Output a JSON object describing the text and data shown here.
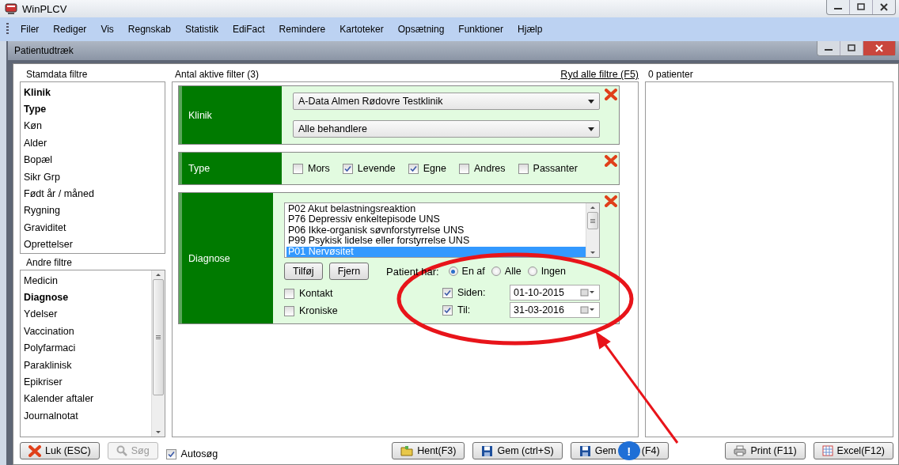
{
  "window": {
    "title": "WinPLCV"
  },
  "menu": [
    "Filer",
    "Rediger",
    "Vis",
    "Regnskab",
    "Statistik",
    "EdiFact",
    "Remindere",
    "Kartoteker",
    "Opsætning",
    "Funktioner",
    "Hjælp"
  ],
  "dialog": {
    "title": "Patientudtræk"
  },
  "stamdata": {
    "heading": "Stamdata filtre",
    "items": [
      {
        "label": "Klinik",
        "active": true
      },
      {
        "label": "Type",
        "active": true
      },
      {
        "label": "Køn",
        "active": false
      },
      {
        "label": "Alder",
        "active": false
      },
      {
        "label": "Bopæl",
        "active": false
      },
      {
        "label": "Sikr Grp",
        "active": false
      },
      {
        "label": "Født år / måned",
        "active": false
      },
      {
        "label": "Rygning",
        "active": false
      },
      {
        "label": "Graviditet",
        "active": false
      },
      {
        "label": "Oprettelser",
        "active": false
      }
    ]
  },
  "andre": {
    "heading": "Andre filtre",
    "items": [
      {
        "label": "Medicin",
        "active": false
      },
      {
        "label": "Diagnose",
        "active": true
      },
      {
        "label": "Ydelser",
        "active": false
      },
      {
        "label": "Vaccination",
        "active": false
      },
      {
        "label": "Polyfarmaci",
        "active": false
      },
      {
        "label": "Paraklinisk",
        "active": false
      },
      {
        "label": "Epikriser",
        "active": false
      },
      {
        "label": "Kalender aftaler",
        "active": false
      },
      {
        "label": "Journalnotat",
        "active": false
      }
    ]
  },
  "filters": {
    "heading": "Antal aktive filter (3)",
    "clear_link": "Ryd alle filtre (F5)"
  },
  "klinik": {
    "label": "Klinik",
    "clinic": "A-Data Almen Rødovre Testklinik",
    "provider": "Alle behandlere"
  },
  "type": {
    "label": "Type",
    "options": [
      {
        "label": "Mors",
        "checked": false
      },
      {
        "label": "Levende",
        "checked": true
      },
      {
        "label": "Egne",
        "checked": true
      },
      {
        "label": "Andres",
        "checked": false
      },
      {
        "label": "Passanter",
        "checked": false
      }
    ]
  },
  "diagnose": {
    "label": "Diagnose",
    "codes": [
      {
        "label": "P02 Akut belastningsreaktion",
        "selected": false
      },
      {
        "label": "P76 Depressiv enkeltepisode UNS",
        "selected": false
      },
      {
        "label": "P06 Ikke-organisk søvnforstyrrelse UNS",
        "selected": false
      },
      {
        "label": "P99 Psykisk lidelse eller forstyrrelse UNS",
        "selected": false
      },
      {
        "label": "P01 Nervøsitet",
        "selected": true
      }
    ],
    "buttons": [
      "Tilføj",
      "Fjern"
    ],
    "patient_har": {
      "label": "Patient har:",
      "options": [
        {
          "label": "En af",
          "selected": true
        },
        {
          "label": "Alle",
          "selected": false
        },
        {
          "label": "Ingen",
          "selected": false
        }
      ]
    },
    "checks": [
      {
        "label": "Kontakt",
        "checked": false
      },
      {
        "label": "Kroniske",
        "checked": false
      }
    ],
    "dates": [
      {
        "label": "Siden:",
        "checked": true,
        "value": "01-10-2015"
      },
      {
        "label": "Til:",
        "checked": true,
        "value": "31-03-2016"
      }
    ]
  },
  "results": {
    "count": "0 patienter"
  },
  "footer": {
    "close": "Luk (ESC)",
    "search": {
      "label": "Søg",
      "disabled": true
    },
    "autosearch": {
      "label": "Autosøg",
      "checked": true
    },
    "load": "Hent(F3)",
    "save": "Gem (ctrl+S)",
    "save_as": [
      "Gem",
      "(F4)"
    ],
    "badge": "!",
    "print": "Print (F11)",
    "excel": "Excel(F12)"
  }
}
